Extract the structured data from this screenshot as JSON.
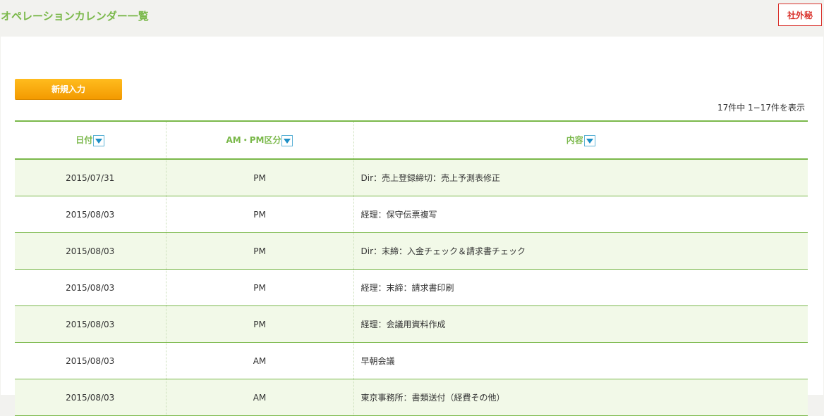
{
  "header": {
    "title": "オペレーションカレンダー一覧",
    "confidential_label": "社外秘"
  },
  "toolbar": {
    "new_button_label": "新規入力",
    "record_count": "17件中 1−17件を表示"
  },
  "table": {
    "columns": [
      {
        "label": "日付",
        "sort_icon": "sort-down-icon"
      },
      {
        "label": "AM・PM区分",
        "sort_icon": "sort-down-icon"
      },
      {
        "label": "内容",
        "sort_icon": "sort-down-icon"
      }
    ],
    "rows": [
      {
        "date": "2015/07/31",
        "ampm": "PM",
        "content": "Dir：売上登録締切：売上予測表修正"
      },
      {
        "date": "2015/08/03",
        "ampm": "PM",
        "content": "経理：保守伝票複写"
      },
      {
        "date": "2015/08/03",
        "ampm": "PM",
        "content": "Dir：末締：入金チェック＆請求書チェック"
      },
      {
        "date": "2015/08/03",
        "ampm": "PM",
        "content": "経理：末締：請求書印刷"
      },
      {
        "date": "2015/08/03",
        "ampm": "PM",
        "content": "経理：会議用資料作成"
      },
      {
        "date": "2015/08/03",
        "ampm": "AM",
        "content": "早朝会議"
      },
      {
        "date": "2015/08/03",
        "ampm": "AM",
        "content": "東京事務所：書類送付（経費その他）"
      }
    ]
  },
  "colors": {
    "accent_green": "#7ab84a",
    "button_orange": "#f39a00",
    "badge_red": "#d9302a",
    "row_stripe": "#f2f9e8"
  }
}
